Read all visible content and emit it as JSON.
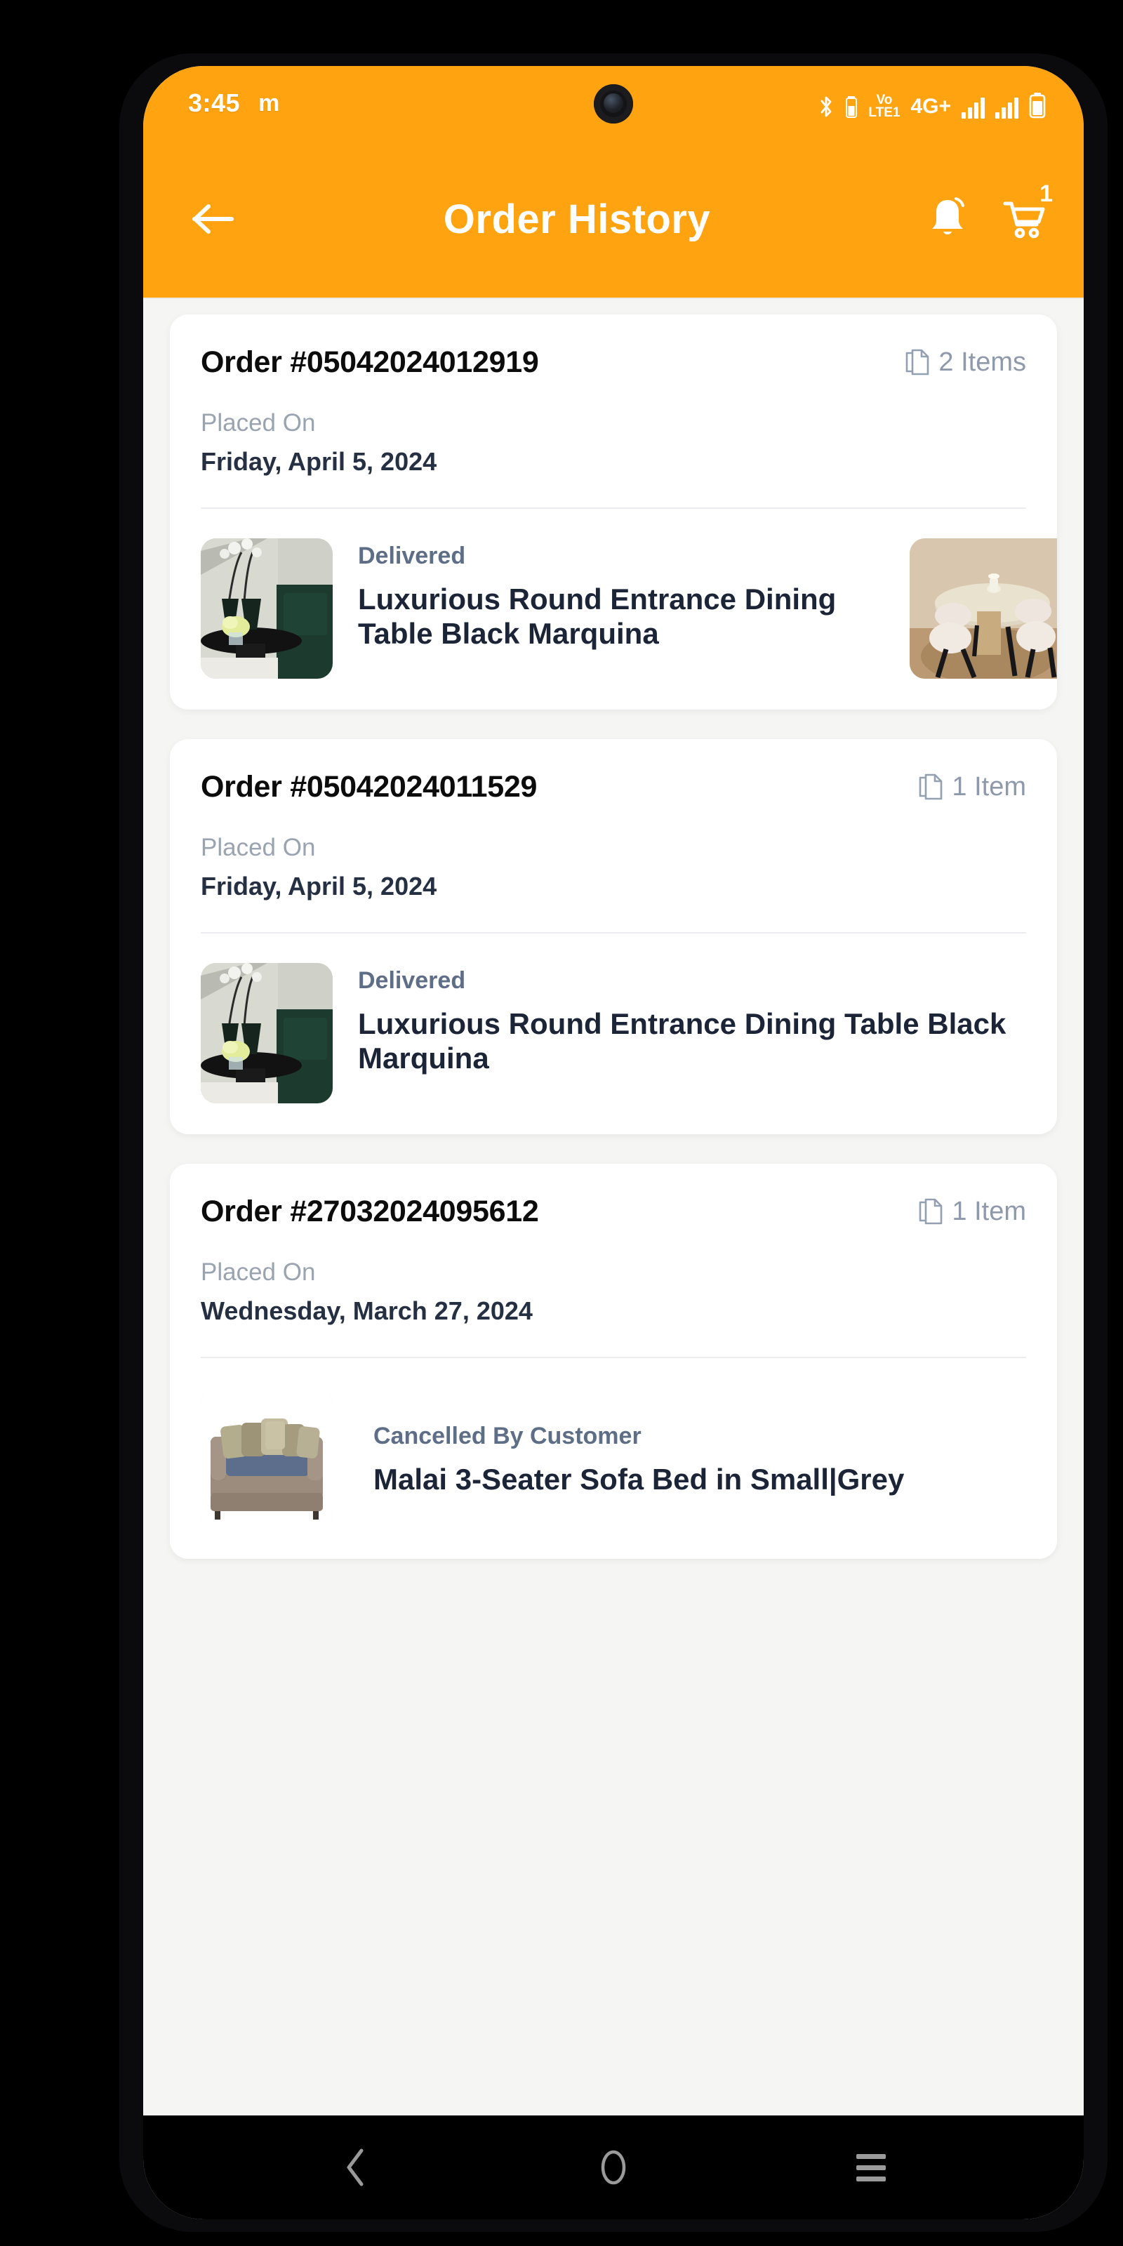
{
  "status_bar": {
    "time": "3:45",
    "app_glyph": "m",
    "icons": [
      "bluetooth-icon",
      "bluetooth-battery-icon",
      "volte-icon",
      "network-type",
      "signal-bars-1",
      "signal-bars-2",
      "battery-icon"
    ],
    "volte_top": "VoLTE",
    "volte_bottom": "LTE1",
    "volte_line1": "Vo",
    "volte_line2": "LTE1",
    "network_type": "4G+"
  },
  "app_bar": {
    "title": "Order History",
    "back_icon": "arrow-left-icon",
    "notification_icon": "bell-icon",
    "cart_icon": "cart-icon",
    "cart_badge": "1",
    "background_color": "#FFA410"
  },
  "orders": [
    {
      "order_id": "Order #05042024012919",
      "items_count_label": "2 Items",
      "items_icon": "copy-documents-icon",
      "placed_on_label": "Placed On",
      "placed_on_date": "Friday, April 5, 2024",
      "products": [
        {
          "status": "Delivered",
          "name": "Luxurious Round Entrance Dining Table Black Marquina",
          "thumb": "dining-table-black-marquina-photo"
        },
        {
          "status": "",
          "name": "",
          "thumb": "oval-dining-table-set-photo"
        }
      ]
    },
    {
      "order_id": "Order #05042024011529",
      "items_count_label": "1 Item",
      "items_icon": "copy-documents-icon",
      "placed_on_label": "Placed On",
      "placed_on_date": "Friday, April 5, 2024",
      "products": [
        {
          "status": "Delivered",
          "name": "Luxurious Round Entrance Dining Table Black Marquina",
          "thumb": "dining-table-black-marquina-photo"
        }
      ]
    },
    {
      "order_id": "Order #27032024095612",
      "items_count_label": "1 Item",
      "items_icon": "copy-documents-icon",
      "placed_on_label": "Placed On",
      "placed_on_date": "Wednesday, March 27, 2024",
      "products": [
        {
          "status": "Cancelled By Customer",
          "name": "Malai 3-Seater Sofa Bed in Small|Grey",
          "thumb": "malai-sofa-bed-grey-photo"
        }
      ]
    }
  ],
  "nav_bar": {
    "back_icon": "chevron-back-icon",
    "home_icon": "home-circle-icon",
    "recents_icon": "recents-menu-icon"
  }
}
